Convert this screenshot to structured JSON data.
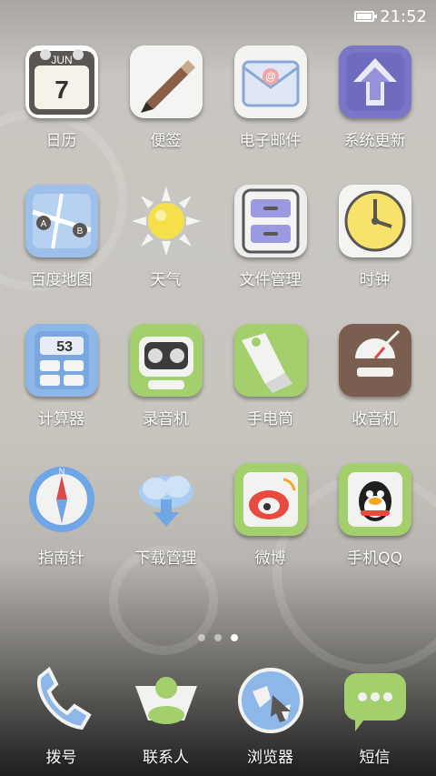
{
  "status_bar": {
    "time": "21:52"
  },
  "apps": [
    {
      "label": "日历",
      "icon": "calendar-icon",
      "color": "#ffffff",
      "detail_top": "JUN",
      "detail_num": "7"
    },
    {
      "label": "便签",
      "icon": "notes-icon",
      "color": "#f4f4f2"
    },
    {
      "label": "电子邮件",
      "icon": "email-icon",
      "color": "#f3f3f1"
    },
    {
      "label": "系统更新",
      "icon": "system-update-icon",
      "color": "#7a78c6"
    },
    {
      "label": "百度地图",
      "icon": "baidu-map-icon",
      "color": "#9dbfe9"
    },
    {
      "label": "天气",
      "icon": "weather-icon",
      "color": "#f7e36b"
    },
    {
      "label": "文件管理",
      "icon": "file-manager-icon",
      "color": "#9b9ae0"
    },
    {
      "label": "时钟",
      "icon": "clock-icon",
      "color": "#f7e36b"
    },
    {
      "label": "计算器",
      "icon": "calculator-icon",
      "color": "#8db7e8",
      "detail_num": "53"
    },
    {
      "label": "录音机",
      "icon": "recorder-icon",
      "color": "#a3cf6c"
    },
    {
      "label": "手电筒",
      "icon": "flashlight-icon",
      "color": "#a3cf6c"
    },
    {
      "label": "收音机",
      "icon": "radio-icon",
      "color": "#7a5f51"
    },
    {
      "label": "指南针",
      "icon": "compass-icon",
      "color": "#6fa6e6"
    },
    {
      "label": "下载管理",
      "icon": "download-manager-icon",
      "color": "#a8cdf1"
    },
    {
      "label": "微博",
      "icon": "weibo-icon",
      "color": "#a3cf6c"
    },
    {
      "label": "手机QQ",
      "icon": "qq-icon",
      "color": "#a3cf6c"
    }
  ],
  "dock": [
    {
      "label": "拨号",
      "icon": "phone-icon",
      "color": "#8db7e8"
    },
    {
      "label": "联系人",
      "icon": "contacts-icon",
      "color": "#a3cf6c"
    },
    {
      "label": "浏览器",
      "icon": "browser-icon",
      "color": "#8db7e8"
    },
    {
      "label": "短信",
      "icon": "messages-icon",
      "color": "#a3cf6c"
    }
  ],
  "page_indicator": {
    "count": 3,
    "active": 3
  }
}
